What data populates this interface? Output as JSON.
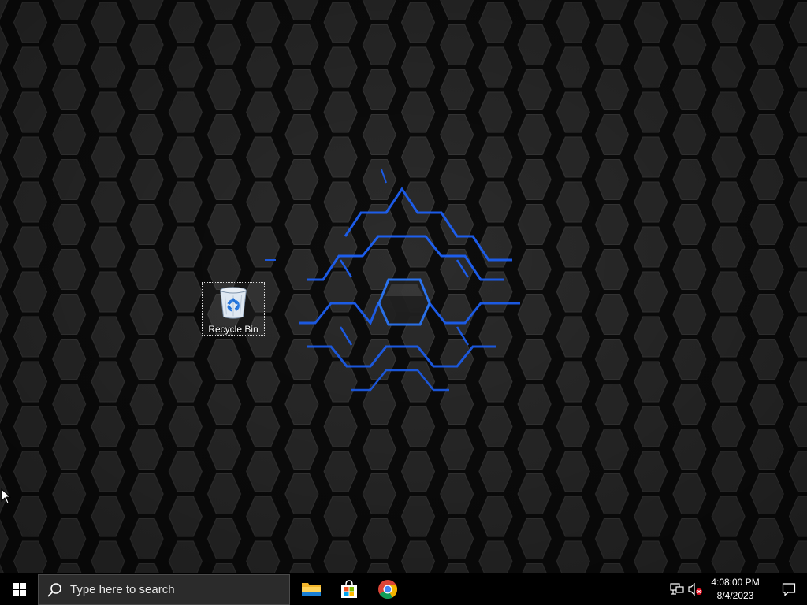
{
  "desktop": {
    "icons": [
      {
        "label": "Recycle Bin",
        "icon": "recycle-bin-icon"
      }
    ]
  },
  "taskbar": {
    "start_icon": "windows-logo-icon",
    "search": {
      "placeholder": "Type here to search",
      "icon": "search-icon"
    },
    "pinned_apps": [
      {
        "name": "File Explorer",
        "icon": "file-explorer-icon"
      },
      {
        "name": "Microsoft Store",
        "icon": "microsoft-store-icon"
      },
      {
        "name": "Google Chrome",
        "icon": "chrome-icon"
      }
    ],
    "tray": {
      "network_icon": "network-icon",
      "volume_icon": "volume-muted-icon",
      "time": "4:08:00 PM",
      "date": "8/4/2023",
      "notification_icon": "notification-icon"
    }
  },
  "colors": {
    "taskbar_bg": "#000000",
    "search_bg": "#2b2b2b",
    "hex_fill": "#2c2c2c",
    "hex_gap": "#0c0c0c",
    "glow": "#1a5cff"
  }
}
